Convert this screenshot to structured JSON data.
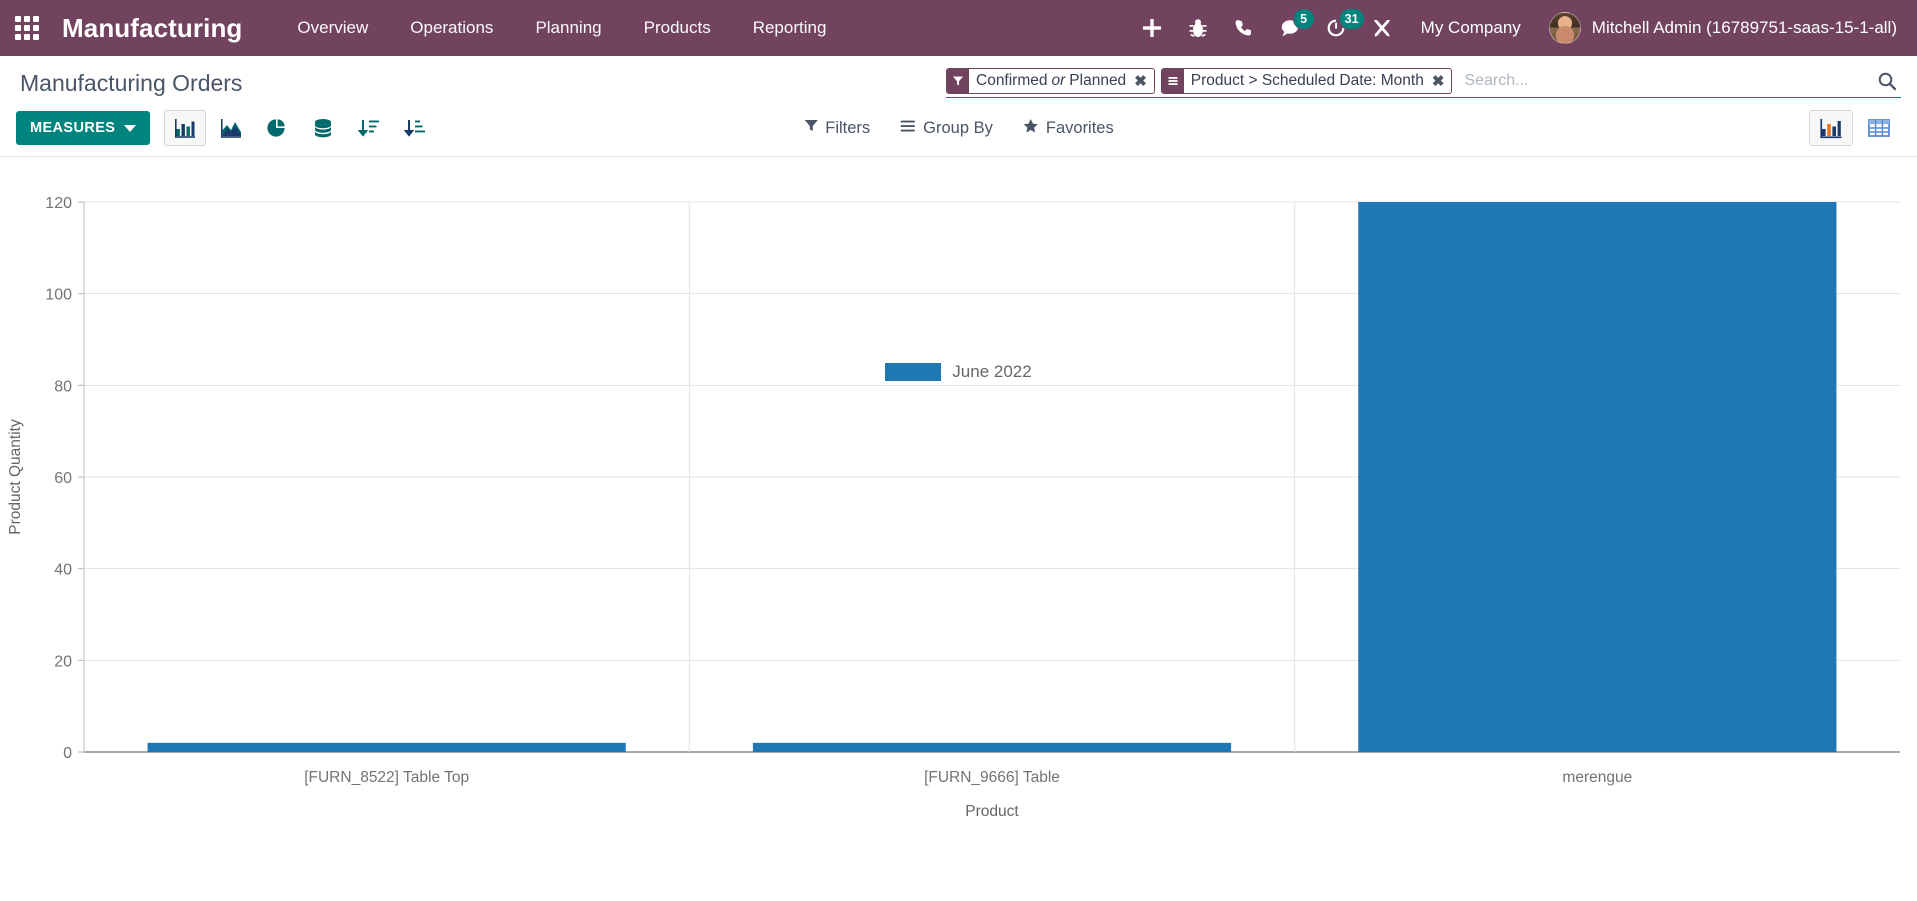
{
  "navbar": {
    "apps_icon": "apps-grid-icon",
    "brand": "Manufacturing",
    "menu": [
      {
        "label": "Overview"
      },
      {
        "label": "Operations"
      },
      {
        "label": "Planning"
      },
      {
        "label": "Products"
      },
      {
        "label": "Reporting"
      }
    ],
    "sys_icons": [
      {
        "name": "plus-icon",
        "badge": ""
      },
      {
        "name": "bug-icon",
        "badge": ""
      },
      {
        "name": "phone-icon",
        "badge": ""
      },
      {
        "name": "messages-icon",
        "badge": "5"
      },
      {
        "name": "activity-clock-icon",
        "badge": "31"
      },
      {
        "name": "wrench-tools-icon",
        "badge": ""
      }
    ],
    "company": "My Company",
    "user": "Mitchell Admin (16789751-saas-15-1-all)"
  },
  "control_panel": {
    "breadcrumb": "Manufacturing Orders",
    "search": {
      "placeholder": "Search...",
      "value": "",
      "search_icon": "search-icon"
    },
    "facets": [
      {
        "icon": "filter-icon",
        "text_before": "Confirmed",
        "text_em": "or",
        "text_after": "Planned",
        "remove": "✖"
      },
      {
        "icon": "groupby-bars-icon",
        "text_before": "Product > Scheduled Date: Month",
        "text_em": "",
        "text_after": "",
        "remove": "✖"
      }
    ],
    "measures_label": "MEASURES",
    "chart_buttons": [
      {
        "name": "bar-chart-icon",
        "active": true
      },
      {
        "name": "line-area-chart-icon",
        "active": false
      },
      {
        "name": "pie-chart-icon",
        "active": false
      },
      {
        "name": "stacked-database-icon",
        "active": false
      },
      {
        "name": "sort-descending-icon",
        "active": false
      },
      {
        "name": "sort-ascending-icon",
        "active": false
      }
    ],
    "dropdowns": [
      {
        "icon": "filter-icon",
        "label": "Filters"
      },
      {
        "icon": "groupby-bars-icon",
        "label": "Group By"
      },
      {
        "icon": "star-icon",
        "label": "Favorites"
      }
    ],
    "view_buttons": [
      {
        "name": "graph-view-icon",
        "active": true
      },
      {
        "name": "list-view-icon",
        "active": false
      }
    ]
  },
  "chart_data": {
    "type": "bar",
    "title": "",
    "xlabel": "Product",
    "ylabel": "Product Quantity",
    "categories": [
      "[FURN_8522] Table Top",
      "[FURN_9666] Table",
      "merengue"
    ],
    "series": [
      {
        "name": "June 2022",
        "color": "#1f77b4",
        "values": [
          2,
          2,
          120
        ]
      }
    ],
    "ylim": [
      0,
      120
    ],
    "yticks": [
      0,
      20,
      40,
      60,
      80,
      100,
      120
    ],
    "grid": true,
    "legend_position": "top-center"
  },
  "colors": {
    "brand_purple": "#71435F",
    "accent_teal": "#00847E",
    "bar_blue": "#1f77b4",
    "text_slate": "#4A5568"
  }
}
